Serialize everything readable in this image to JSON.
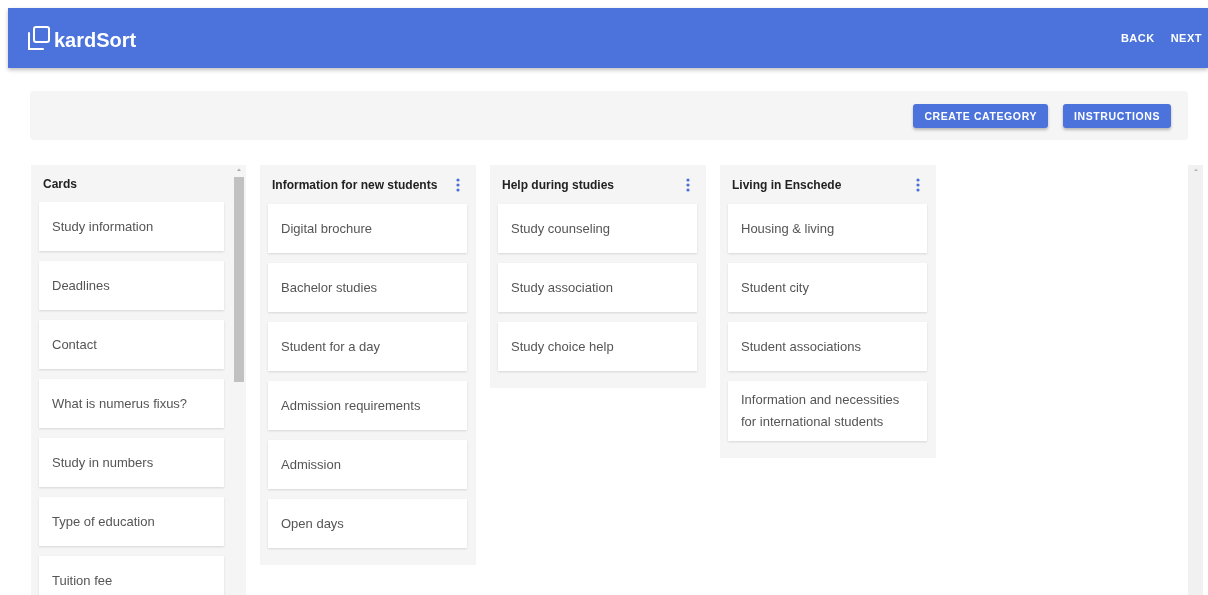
{
  "app_bar": {
    "logo_text": "kardSort",
    "nav": [
      "BACK",
      "NEXT"
    ]
  },
  "toolbar": {
    "buttons": [
      "CREATE CATEGORY",
      "INSTRUCTIONS"
    ]
  },
  "cards_panel": {
    "title": "Cards",
    "cards": [
      "Study information",
      "Deadlines",
      "Contact",
      "What is numerus fixus?",
      "Study in numbers",
      "Type of education",
      "Tuition fee"
    ]
  },
  "categories": [
    {
      "title": "Information for new students",
      "cards": [
        "Digital brochure",
        "Bachelor studies",
        "Student for a day",
        "Admission requirements",
        "Admission",
        "Open days"
      ]
    },
    {
      "title": "Help during studies",
      "cards": [
        "Study counseling",
        "Study association",
        "Study choice help"
      ]
    },
    {
      "title": "Living in Enschede",
      "cards": [
        "Housing & living",
        "Student city",
        "Student associations",
        "Information and necessities for international students"
      ]
    }
  ]
}
